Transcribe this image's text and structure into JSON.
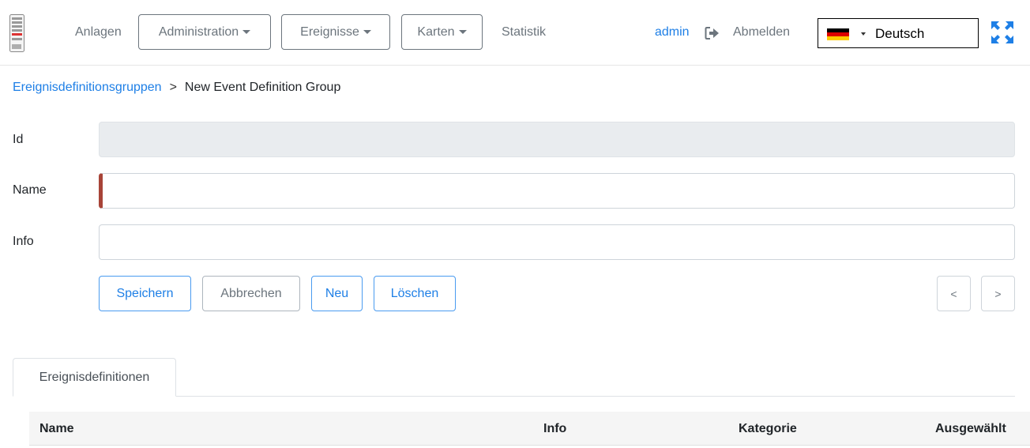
{
  "header": {
    "nav": {
      "anlagen": "Anlagen",
      "administration": "Administration",
      "ereignisse": "Ereignisse",
      "karten": "Karten",
      "statistik": "Statistik"
    },
    "user": "admin",
    "logout": "Abmelden",
    "language": {
      "selected": "Deutsch",
      "flag": "german-flag"
    },
    "icons": {
      "logo": "server-logo-icon",
      "logout": "sign-out-icon",
      "fullscreen": "expand-arrows-icon"
    }
  },
  "breadcrumb": {
    "parent": "Ereignisdefinitionsgruppen",
    "separator": ">",
    "current": "New Event Definition Group"
  },
  "form": {
    "id_label": "Id",
    "id_value": "",
    "name_label": "Name",
    "name_value": "",
    "info_label": "Info",
    "info_value": ""
  },
  "buttons": {
    "save": "Speichern",
    "cancel": "Abbrechen",
    "new": "Neu",
    "delete": "Löschen",
    "prev": "<",
    "next": ">"
  },
  "tabs": [
    {
      "label": "Ereignisdefinitionen"
    }
  ],
  "table": {
    "columns": [
      "Name",
      "Info",
      "Kategorie",
      "Ausgewählt"
    ]
  },
  "colors": {
    "primary": "#1e7fe6",
    "required_marker": "#a84438",
    "fullscreen_icon": "#1e7fe6"
  }
}
